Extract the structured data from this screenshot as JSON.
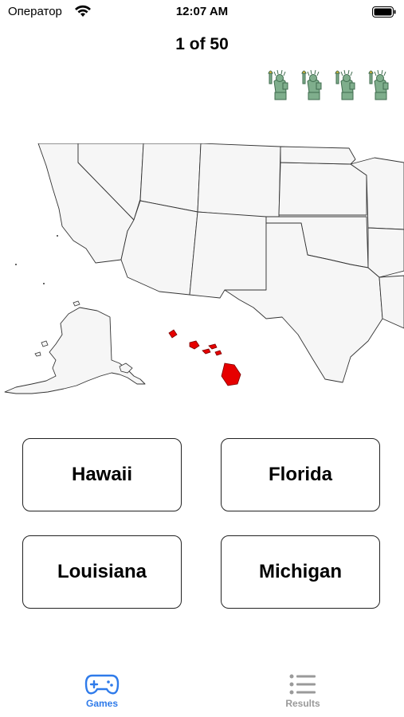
{
  "status_bar": {
    "carrier": "Оператор",
    "time": "12:07 AM",
    "icons": [
      "wifi-icon",
      "battery-icon"
    ]
  },
  "quiz": {
    "progress": "1 of 50",
    "lives_remaining": 4,
    "life_icon": "statue-of-liberty-icon",
    "highlight_color": "#e60000",
    "highlighted_state": "Hawaii"
  },
  "answers": [
    {
      "label": "Hawaii"
    },
    {
      "label": "Florida"
    },
    {
      "label": "Louisiana"
    },
    {
      "label": "Michigan"
    }
  ],
  "tab_bar": {
    "tabs": [
      {
        "label": "Games",
        "icon": "gamepad-icon",
        "active": true,
        "color": "#2f7bea"
      },
      {
        "label": "Results",
        "icon": "list-icon",
        "active": false,
        "color": "#9a9a9a"
      }
    ]
  }
}
